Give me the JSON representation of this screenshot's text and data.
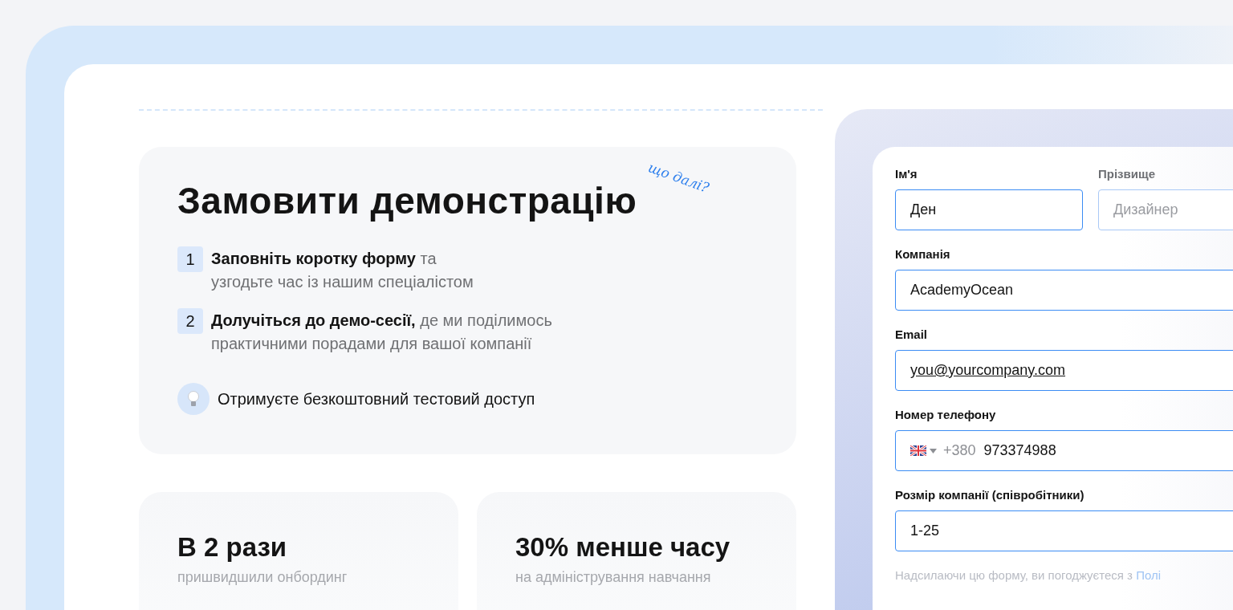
{
  "heading": {
    "title": "Замовити демонстрацію",
    "note": "що далі?"
  },
  "steps": [
    {
      "number": "1",
      "text": "**Заповніть коротку форму** та\nузгодьте час із нашим спеціалістом"
    },
    {
      "number": "2",
      "text": "**Долучіться до демо-сесії,** де ми поділимось\nпрактичними порадами для вашої компанії"
    }
  ],
  "perk": {
    "text": "Отримуєте безкоштовний тестовий доступ"
  },
  "stats": [
    {
      "value": "В 2 рази",
      "caption": "пришвидшили онбординг"
    },
    {
      "value": "30% менше часу",
      "caption": "на адміністрування навчання"
    }
  ],
  "form": {
    "name_fields": [
      {
        "label": "Ім'я",
        "value": "Ден"
      },
      {
        "label": "Прізвище",
        "placeholder": "Дизайнер"
      }
    ],
    "fields": [
      {
        "kind": "text",
        "label": "Компанія",
        "value": "AcademyOcean"
      },
      {
        "kind": "email",
        "label": "Email",
        "value": "you@yourcompany.com"
      },
      {
        "kind": "phone",
        "label": "Номер телефону",
        "prefix": "+380",
        "value": "973374988"
      },
      {
        "kind": "text",
        "label": "Розмір компанії (співробітники)",
        "value": "1-25"
      }
    ],
    "disclaimer": "Надсилаючи цю форму, ви погоджуєтеся з",
    "disclaimer_link": "Полі"
  }
}
